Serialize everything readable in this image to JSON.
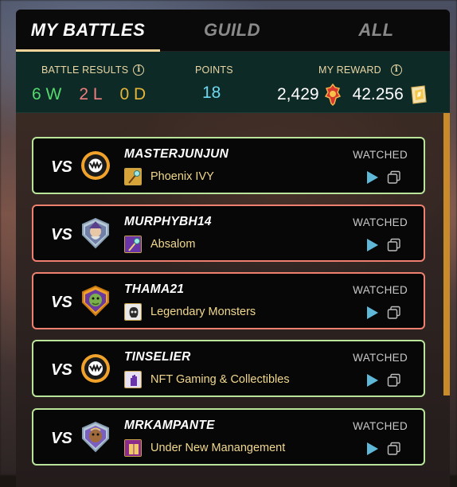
{
  "tabs": [
    {
      "label": "MY BATTLES",
      "active": true
    },
    {
      "label": "GUILD",
      "active": false
    },
    {
      "label": "ALL",
      "active": false
    }
  ],
  "stats": {
    "battle_results_label": "BATTLE RESULTS",
    "wins": "6 W",
    "losses": "2 L",
    "draws": "0 D",
    "points_label": "POINTS",
    "points_value": "18",
    "reward_label": "MY REWARD",
    "reward_dec": "2,429",
    "reward_sps": "42.256"
  },
  "battles": [
    {
      "vs": "VS",
      "opponent": "MASTERJUNJUN",
      "guild": "Phoenix IVY",
      "status": "WATCHED",
      "result": "win",
      "avatar_icon": "monster-face-icon",
      "guild_icon": "staff-icon"
    },
    {
      "vs": "VS",
      "opponent": "MURPHYBH14",
      "guild": "Absalom",
      "status": "WATCHED",
      "result": "loss",
      "avatar_icon": "wizard-avatar-icon",
      "guild_icon": "wand-icon"
    },
    {
      "vs": "VS",
      "opponent": "THAMA21",
      "guild": "Legendary Monsters",
      "status": "WATCHED",
      "result": "loss",
      "avatar_icon": "goblin-avatar-icon",
      "guild_icon": "skull-icon"
    },
    {
      "vs": "VS",
      "opponent": "TINSELIER",
      "guild": "NFT Gaming & Collectibles",
      "status": "WATCHED",
      "result": "win",
      "avatar_icon": "monster-face-icon",
      "guild_icon": "hand-icon"
    },
    {
      "vs": "VS",
      "opponent": "MRKAMPANTE",
      "guild": "Under New Manangement",
      "status": "WATCHED",
      "result": "win",
      "avatar_icon": "creature-avatar-icon",
      "guild_icon": "book-icon"
    }
  ],
  "colors": {
    "win_border": "#b9e49a",
    "loss_border": "#ef8070",
    "accent": "#f0d49a",
    "stats_bg": "#0e2a26"
  }
}
